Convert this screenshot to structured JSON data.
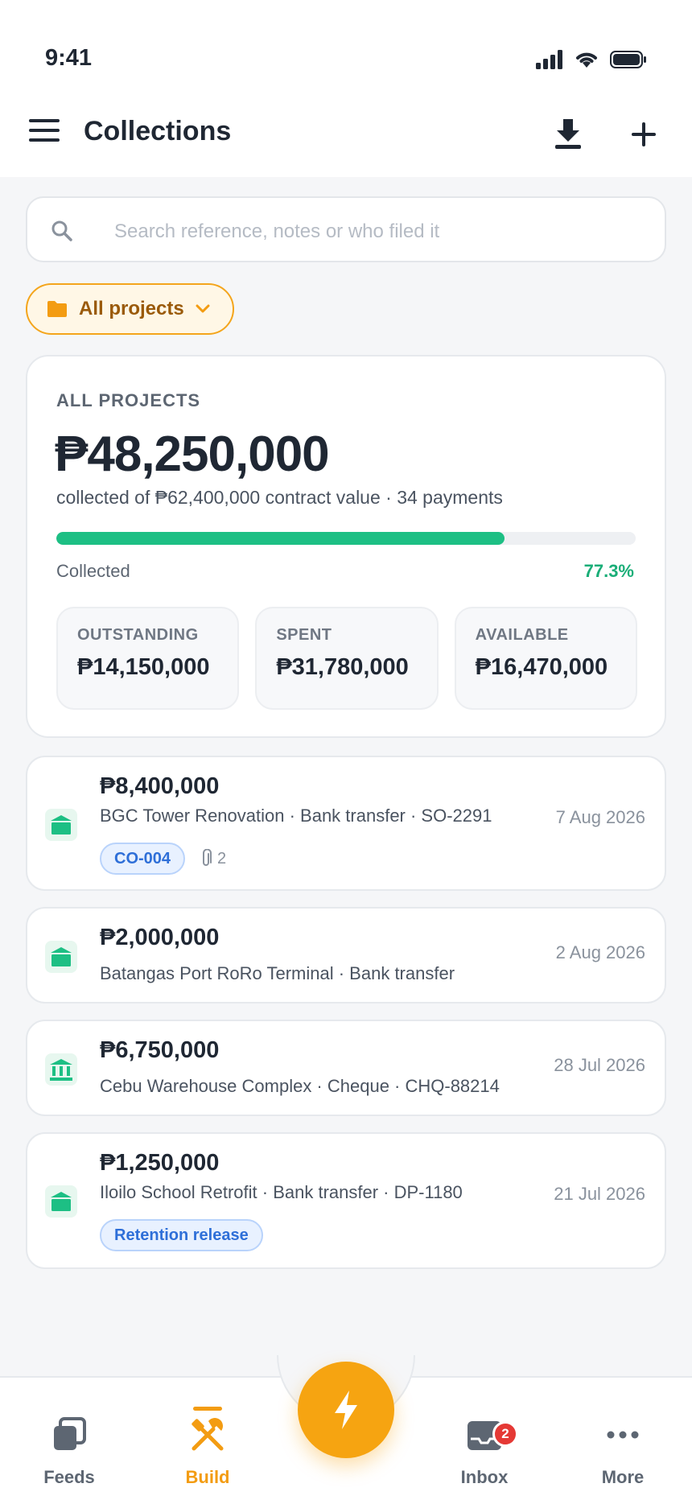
{
  "status": {
    "time": "9:41"
  },
  "header": {
    "title": "Collections"
  },
  "search": {
    "placeholder": "Search reference, notes or who filed it"
  },
  "filter": {
    "label": "All projects"
  },
  "summary": {
    "label": "ALL PROJECTS",
    "collected": "₱48,250,000",
    "subtitle": "collected of ₱62,400,000 contract value · 34 payments",
    "progress_label": "Collected",
    "progress_pct_text": "77.3%",
    "progress_fraction": 0.773,
    "stats": [
      {
        "label": "OUTSTANDING",
        "value": "₱14,150,000"
      },
      {
        "label": "SPENT",
        "value": "₱31,780,000"
      },
      {
        "label": "AVAILABLE",
        "value": "₱16,470,000"
      }
    ]
  },
  "payments": [
    {
      "amount": "₱8,400,000",
      "desc": "BGC Tower Renovation · Bank transfer · SO-2291",
      "date": "7 Aug 2026",
      "tag": "CO-004",
      "attachments": "2",
      "icon": "bank-transfer-icon"
    },
    {
      "amount": "₱2,000,000",
      "desc": "Batangas Port RoRo Terminal · Bank transfer",
      "date": "2 Aug 2026",
      "icon": "bank-transfer-icon"
    },
    {
      "amount": "₱6,750,000",
      "desc": "Cebu Warehouse Complex · Cheque · CHQ-88214",
      "date": "28 Jul 2026",
      "icon": "bank-building-icon"
    },
    {
      "amount": "₱1,250,000",
      "desc": "Iloilo School Retrofit · Bank transfer · DP-1180",
      "date": "21 Jul 2026",
      "tag": "Retention release",
      "icon": "bank-transfer-icon"
    }
  ],
  "nav": {
    "feeds": "Feeds",
    "build": "Build",
    "inbox": "Inbox",
    "inbox_badge": "2",
    "more": "More"
  },
  "colors": {
    "accent": "#f6a411",
    "success": "#1dbf84",
    "tag_blue": "#2e6fd8"
  }
}
